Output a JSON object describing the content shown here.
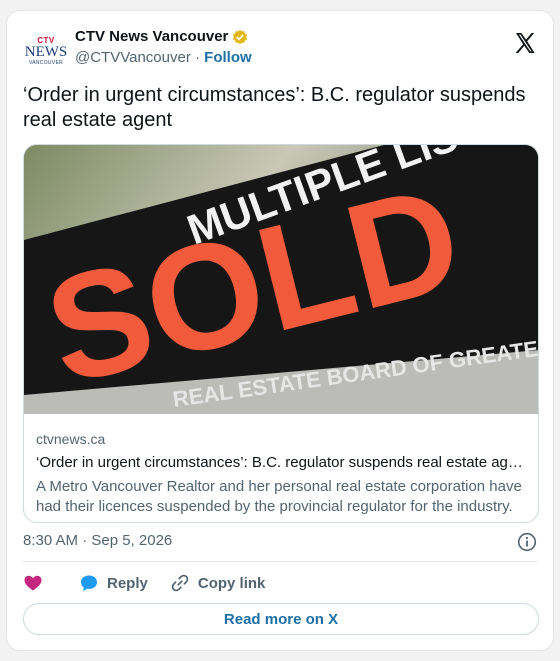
{
  "account": {
    "display_name": "CTV News Vancouver",
    "handle": "@CTVVancouver",
    "separator": "·",
    "follow_label": "Follow",
    "logo_ctv": "CTV",
    "logo_news": "NEWS",
    "logo_city": "VANCOUVER"
  },
  "tweet": {
    "text": "‘Order in urgent circumstances’: B.C. regulator suspends real estate agent"
  },
  "link_card": {
    "image": {
      "sign_word": "SOLD",
      "banner_text": "MULTIPLE LISTING",
      "bottom_text": "REAL ESTATE BOARD OF GREATER VANCOUVER"
    },
    "domain": "ctvnews.ca",
    "title": "‘Order in urgent circumstances’: B.C. regulator suspends real estate ag…",
    "description": "A Metro Vancouver Realtor and her personal real estate corporation have had their licences suspended by the provincial regulator for the industry."
  },
  "timestamp": "8:30 AM · Sep 5, 2026",
  "actions": {
    "reply_label": "Reply",
    "copy_link_label": "Copy link"
  },
  "read_more_label": "Read more on X",
  "colors": {
    "like": "#f91880",
    "reply": "#1d9bf0",
    "link_blue": "#1d6fa5",
    "sign_orange": "#f15a3a",
    "verified_gold": "#e2b719"
  },
  "icons": [
    "verified-badge-icon",
    "x-logo-icon",
    "info-icon",
    "heart-icon",
    "reply-bubble-icon",
    "link-icon"
  ]
}
